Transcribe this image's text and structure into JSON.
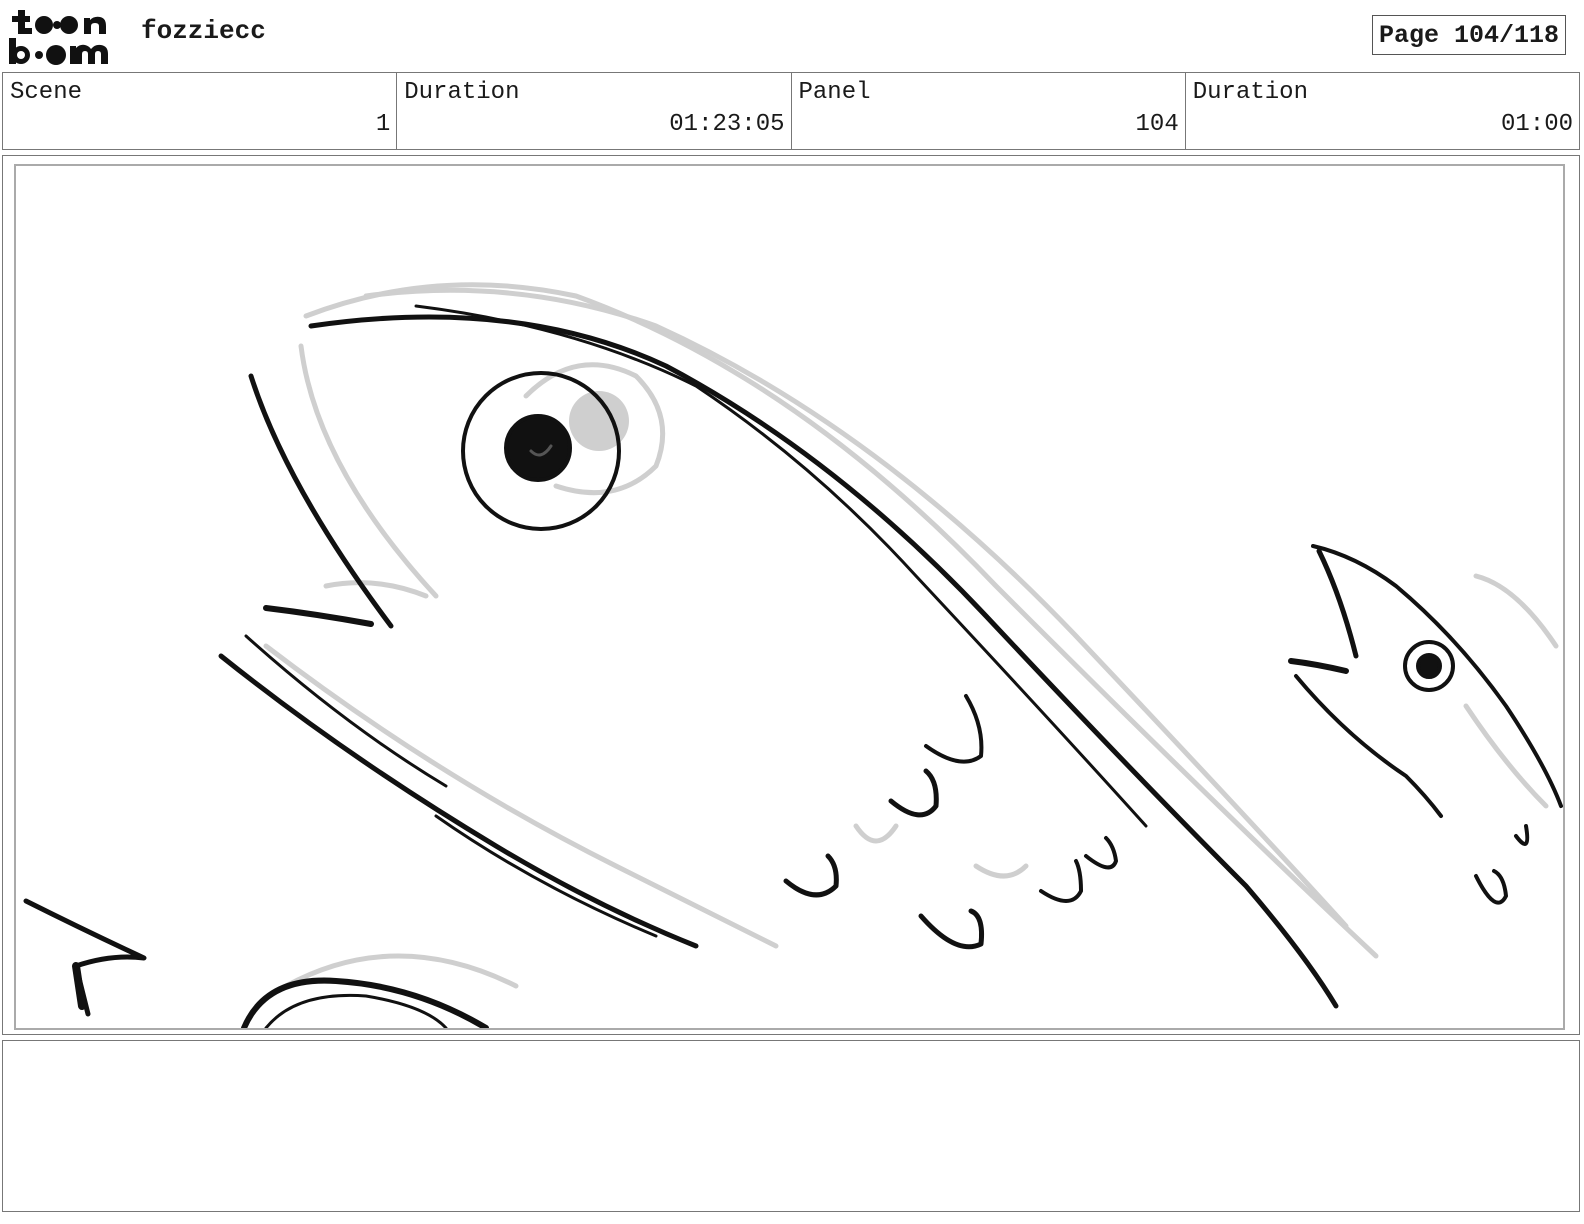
{
  "header": {
    "logo_top": "toon",
    "logo_bottom": "boom",
    "project_name": "fozziecc",
    "page_label": "Page 104/118"
  },
  "info": [
    {
      "label": "Scene",
      "value": "1"
    },
    {
      "label": "Duration",
      "value": "01:23:05"
    },
    {
      "label": "Panel",
      "value": "104"
    },
    {
      "label": "Duration",
      "value": "01:00"
    }
  ],
  "panel": {
    "drawing": "fish-sketch",
    "stroke_dark": "#111111",
    "stroke_light": "#c8c8c8"
  },
  "notes": {
    "action_text": "",
    "dialogue_text": ""
  }
}
